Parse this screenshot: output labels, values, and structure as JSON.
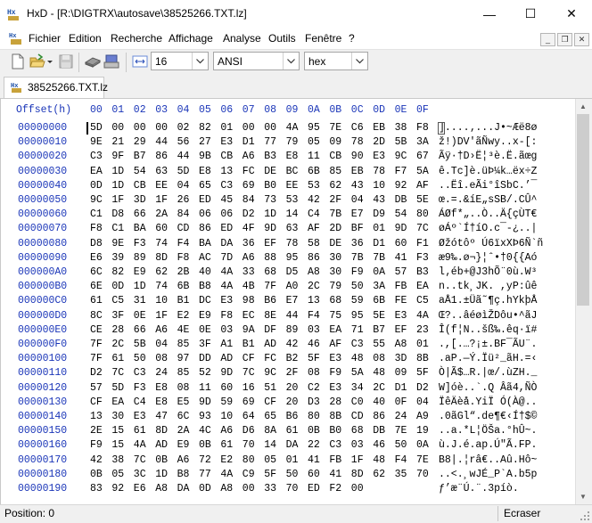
{
  "window": {
    "title": "HxD - [R:\\DIGTRX\\autosave\\38525266.TXT.lz]",
    "minimize": "—",
    "maximize": "☐",
    "close": "✕"
  },
  "menu": {
    "items": [
      "Fichier",
      "Edition",
      "Recherche",
      "Affichage",
      "Analyse",
      "Outils",
      "Fenêtre",
      "?"
    ],
    "mdi_min": "_",
    "mdi_restore": "❐",
    "mdi_close": "✕"
  },
  "toolbar": {
    "bytes_per_row": "16",
    "charset": "ANSI",
    "offset_base": "hex"
  },
  "tab": {
    "label": "38525266.TXT.lz"
  },
  "editor": {
    "offset_header": "Offset(h)",
    "columns": [
      "00",
      "01",
      "02",
      "03",
      "04",
      "05",
      "06",
      "07",
      "08",
      "09",
      "0A",
      "0B",
      "0C",
      "0D",
      "0E",
      "0F"
    ],
    "rows": [
      {
        "offset": "00000000",
        "hex": [
          "5D",
          "00",
          "00",
          "00",
          "02",
          "82",
          "01",
          "00",
          "00",
          "4A",
          "95",
          "7E",
          "C6",
          "EB",
          "38",
          "F8"
        ],
        "ascii": "]....‚...J•~Æë8ø"
      },
      {
        "offset": "00000010",
        "hex": [
          "9E",
          "21",
          "29",
          "44",
          "56",
          "27",
          "E3",
          "D1",
          "77",
          "79",
          "05",
          "09",
          "78",
          "2D",
          "5B",
          "3A"
        ],
        "ascii": "ž!)DV'ãÑwy..x-[:"
      },
      {
        "offset": "00000020",
        "hex": [
          "C3",
          "9F",
          "B7",
          "86",
          "44",
          "9B",
          "CB",
          "A6",
          "B3",
          "E8",
          "11",
          "CB",
          "90",
          "E3",
          "9C",
          "67"
        ],
        "ascii": "Ãÿ·†D›Ë¦³è.Ë.ãœg"
      },
      {
        "offset": "00000030",
        "hex": [
          "EA",
          "1D",
          "54",
          "63",
          "5D",
          "E8",
          "13",
          "FC",
          "DE",
          "BC",
          "6B",
          "85",
          "EB",
          "78",
          "F7",
          "5A"
        ],
        "ascii": "ê.Tc]è.üÞ¼k…ëx÷Z"
      },
      {
        "offset": "00000040",
        "hex": [
          "0D",
          "1D",
          "CB",
          "EE",
          "04",
          "65",
          "C3",
          "69",
          "B0",
          "EE",
          "53",
          "62",
          "43",
          "10",
          "92",
          "AF"
        ],
        "ascii": "..Ëî.eÃi°îSbC.’¯"
      },
      {
        "offset": "00000050",
        "hex": [
          "9C",
          "1F",
          "3D",
          "1F",
          "26",
          "ED",
          "45",
          "84",
          "73",
          "53",
          "42",
          "2F",
          "04",
          "43",
          "DB",
          "5E"
        ],
        "ascii": "œ.=.&íE„sSB/.CÛ^"
      },
      {
        "offset": "00000060",
        "hex": [
          "C1",
          "D8",
          "66",
          "2A",
          "84",
          "06",
          "06",
          "D2",
          "1D",
          "14",
          "C4",
          "7B",
          "E7",
          "D9",
          "54",
          "80"
        ],
        "ascii": "ÁØf*„..Ò..Ä{çÙT€"
      },
      {
        "offset": "00000070",
        "hex": [
          "F8",
          "C1",
          "BA",
          "60",
          "CD",
          "86",
          "ED",
          "4F",
          "9D",
          "63",
          "AF",
          "2D",
          "BF",
          "01",
          "9D",
          "7C"
        ],
        "ascii": "øÁº`Í†íO.c¯-¿..|"
      },
      {
        "offset": "00000080",
        "hex": [
          "D8",
          "9E",
          "F3",
          "74",
          "F4",
          "BA",
          "DA",
          "36",
          "EF",
          "78",
          "58",
          "DE",
          "36",
          "D1",
          "60",
          "F1"
        ],
        "ascii": "Øžótôº Ú6ïxXÞ6Ñ`ñ"
      },
      {
        "offset": "00000090",
        "hex": [
          "E6",
          "39",
          "89",
          "8D",
          "F8",
          "AC",
          "7D",
          "A6",
          "88",
          "95",
          "86",
          "30",
          "7B",
          "7B",
          "41",
          "F3"
        ],
        "ascii": "æ9‰.ø¬}¦ˆ•†0{{Aó"
      },
      {
        "offset": "000000A0",
        "hex": [
          "6C",
          "82",
          "E9",
          "62",
          "2B",
          "40",
          "4A",
          "33",
          "68",
          "D5",
          "A8",
          "30",
          "F9",
          "0A",
          "57",
          "B3"
        ],
        "ascii": "l‚éb+@J3hÕ¨0ù.W³"
      },
      {
        "offset": "000000B0",
        "hex": [
          "6E",
          "0D",
          "1D",
          "74",
          "6B",
          "B8",
          "4A",
          "4B",
          "7F",
          "A0",
          "2C",
          "79",
          "50",
          "3A",
          "FB",
          "EA"
        ],
        "ascii": "n..tk¸JK. ,yP:ûê"
      },
      {
        "offset": "000000C0",
        "hex": [
          "61",
          "C5",
          "31",
          "10",
          "B1",
          "DC",
          "E3",
          "98",
          "B6",
          "E7",
          "13",
          "68",
          "59",
          "6B",
          "FE",
          "C5"
        ],
        "ascii": "aÅ1.±Üã˜¶ç.hYkþÅ"
      },
      {
        "offset": "000000D0",
        "hex": [
          "8C",
          "3F",
          "0E",
          "1F",
          "E2",
          "E9",
          "F8",
          "EC",
          "8E",
          "44",
          "F4",
          "75",
          "95",
          "5E",
          "E3",
          "4A"
        ],
        "ascii": "Œ?..âéøìŽDôu•^ãJ"
      },
      {
        "offset": "000000E0",
        "hex": [
          "CE",
          "28",
          "66",
          "A6",
          "4E",
          "0E",
          "03",
          "9A",
          "DF",
          "89",
          "03",
          "EA",
          "71",
          "B7",
          "EF",
          "23"
        ],
        "ascii": "Î(f¦N..šß‰.êq·ï#"
      },
      {
        "offset": "000000F0",
        "hex": [
          "7F",
          "2C",
          "5B",
          "04",
          "85",
          "3F",
          "A1",
          "B1",
          "AD",
          "42",
          "46",
          "AF",
          "C3",
          "55",
          "A8",
          "01"
        ],
        "ascii": ".,[.…?¡±.BF¯ÃU¨."
      },
      {
        "offset": "00000100",
        "hex": [
          "7F",
          "61",
          "50",
          "08",
          "97",
          "DD",
          "AD",
          "CF",
          "FC",
          "B2",
          "5F",
          "E3",
          "48",
          "08",
          "3D",
          "8B"
        ],
        "ascii": ".aP.—Ý.Ïü²_ãH.=‹"
      },
      {
        "offset": "00000110",
        "hex": [
          "D2",
          "7C",
          "C3",
          "24",
          "85",
          "52",
          "9D",
          "7C",
          "9C",
          "2F",
          "08",
          "F9",
          "5A",
          "48",
          "09",
          "5F"
        ],
        "ascii": "Ò|Ã$…R.|œ/.ùZH._"
      },
      {
        "offset": "00000120",
        "hex": [
          "57",
          "5D",
          "F3",
          "E8",
          "08",
          "11",
          "60",
          "16",
          "51",
          "20",
          "C2",
          "E3",
          "34",
          "2C",
          "D1",
          "D2"
        ],
        "ascii": "W]óè..`.Q Âã4,ÑÒ"
      },
      {
        "offset": "00000130",
        "hex": [
          "CF",
          "EA",
          "C4",
          "E8",
          "E5",
          "9D",
          "59",
          "69",
          "CF",
          "20",
          "D3",
          "28",
          "C0",
          "40",
          "0F",
          "04"
        ],
        "ascii": "ÏêÄèå.YiÏ Ó(À@.."
      },
      {
        "offset": "00000140",
        "hex": [
          "13",
          "30",
          "E3",
          "47",
          "6C",
          "93",
          "10",
          "64",
          "65",
          "B6",
          "80",
          "8B",
          "CD",
          "86",
          "24",
          "A9"
        ],
        "ascii": ".0ãGl“.de¶€‹Í†$©"
      },
      {
        "offset": "00000150",
        "hex": [
          "2E",
          "15",
          "61",
          "8D",
          "2A",
          "4C",
          "A6",
          "D6",
          "8A",
          "61",
          "0B",
          "B0",
          "68",
          "DB",
          "7E",
          "19"
        ],
        "ascii": "..a.*L¦ÖŠa.°hÛ~."
      },
      {
        "offset": "00000160",
        "hex": [
          "F9",
          "15",
          "4A",
          "AD",
          "E9",
          "0B",
          "61",
          "70",
          "14",
          "DA",
          "22",
          "C3",
          "03",
          "46",
          "50",
          "0A"
        ],
        "ascii": "ù.J.é.ap.Ú\"Ã.FP."
      },
      {
        "offset": "00000170",
        "hex": [
          "42",
          "38",
          "7C",
          "0B",
          "A6",
          "72",
          "E2",
          "80",
          "05",
          "01",
          "41",
          "FB",
          "1F",
          "48",
          "F4",
          "7E"
        ],
        "ascii": "B8|.¦râ€..Aû.Hô~"
      },
      {
        "offset": "00000180",
        "hex": [
          "0B",
          "05",
          "3C",
          "1D",
          "B8",
          "77",
          "4A",
          "C9",
          "5F",
          "50",
          "60",
          "41",
          "8D",
          "62",
          "35",
          "70"
        ],
        "ascii": "..<.¸wJÉ_P`A.b5p"
      },
      {
        "offset": "00000190",
        "hex": [
          "83",
          "92",
          "E6",
          "A8",
          "DA",
          "0D",
          "A8",
          "00",
          "33",
          "70",
          "ED",
          "F2",
          "00",
          "",
          "",
          ""
        ],
        "ascii": "ƒ’æ¨Ú.¨.3píò."
      }
    ]
  },
  "status": {
    "position": "Position: 0",
    "mode": "Ecraser"
  }
}
